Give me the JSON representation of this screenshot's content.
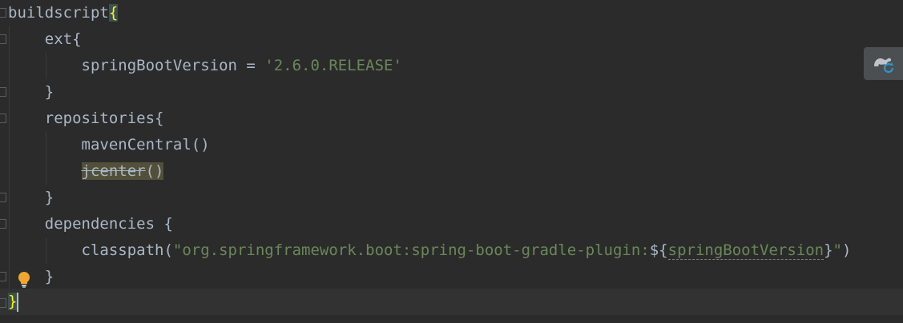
{
  "editor": {
    "lines": [
      {
        "id": "l1",
        "parts": [
          "buildscript",
          "{"
        ]
      },
      {
        "id": "l2",
        "parts": [
          "    ext{"
        ]
      },
      {
        "id": "l3",
        "parts": [
          "        springBootVersion = ",
          "'2.6.0.RELEASE'"
        ]
      },
      {
        "id": "l4",
        "parts": [
          "    }"
        ]
      },
      {
        "id": "l5",
        "parts": [
          "    repositories{"
        ]
      },
      {
        "id": "l6",
        "parts": [
          "        mavenCentral()"
        ]
      },
      {
        "id": "l7",
        "parts": [
          "        ",
          "jcenter",
          "()"
        ]
      },
      {
        "id": "l8",
        "parts": [
          "    }"
        ]
      },
      {
        "id": "l9",
        "parts": [
          "    dependencies {"
        ]
      },
      {
        "id": "l10",
        "parts": [
          "        classpath(",
          "\"org.springframework.boot:spring-boot-gradle-plugin:",
          "${",
          "springBootVersion",
          "}",
          "\"",
          ")"
        ]
      },
      {
        "id": "l11",
        "parts": [
          "    }"
        ]
      },
      {
        "id": "l12",
        "parts": [
          "}"
        ]
      }
    ]
  },
  "icons": {
    "intention_bulb": "lightbulb-icon",
    "gradle_reload": "gradle-reload-icon"
  },
  "colors": {
    "background": "#2b2b2b",
    "text": "#a9b7c6",
    "string": "#6a8759",
    "brace_match": "#ffef28",
    "warning_bg": "#52503a",
    "bulb": "#f0a732",
    "gradle_accent": "#3592c4"
  }
}
